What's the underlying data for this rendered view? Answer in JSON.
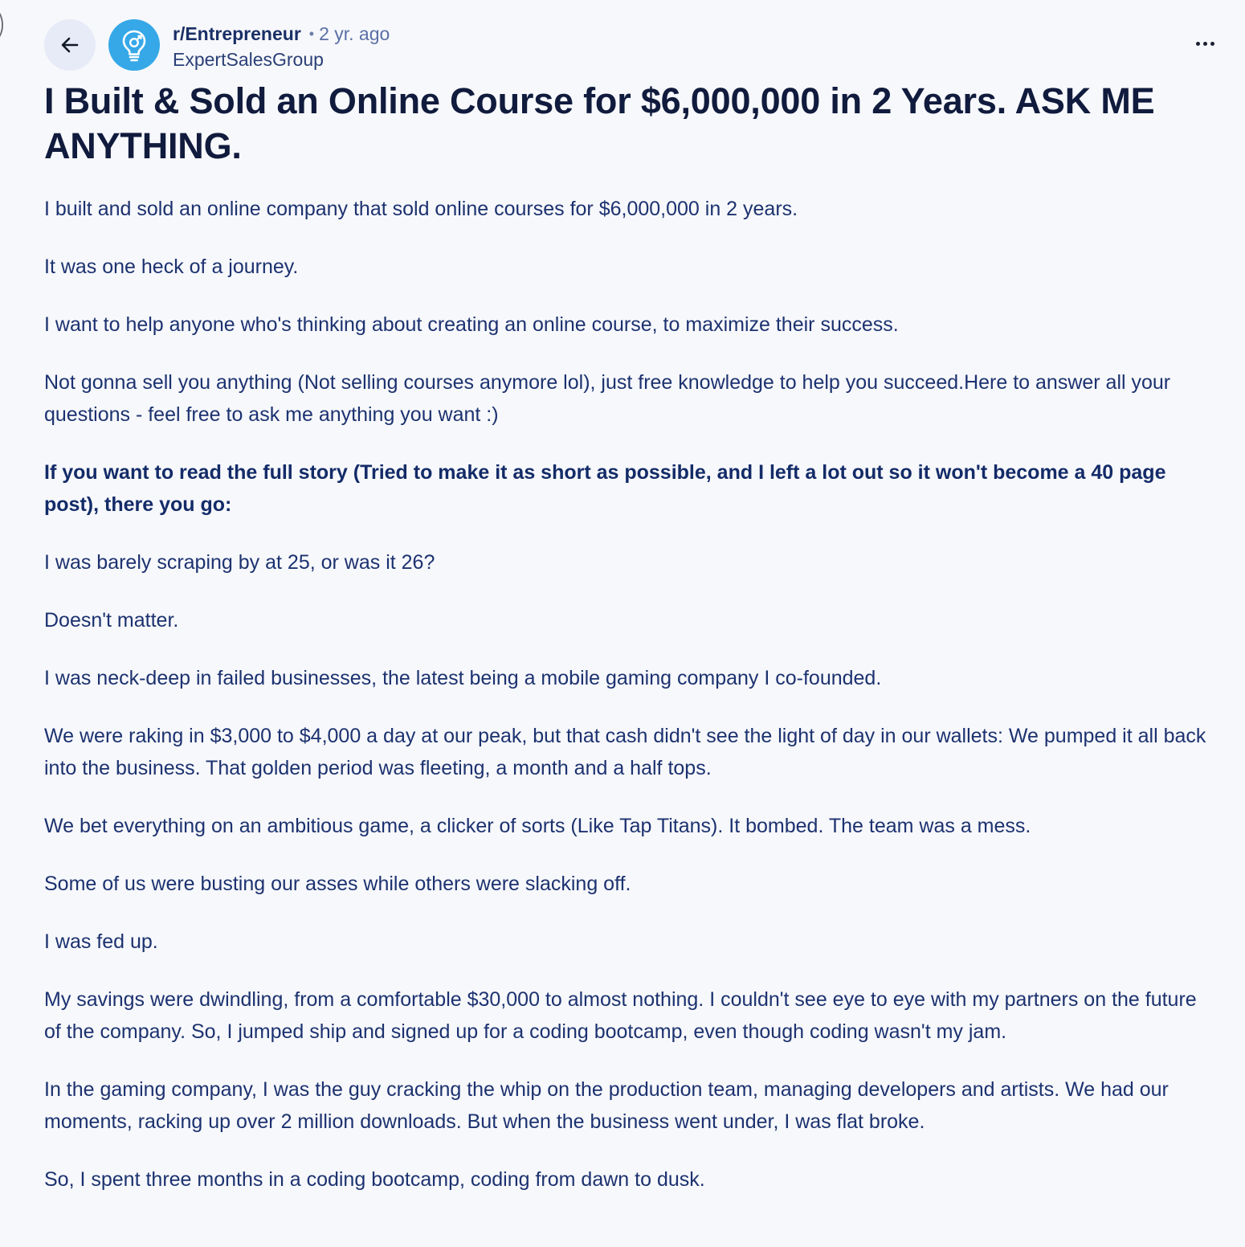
{
  "header": {
    "subreddit": "r/Entrepreneur",
    "dot": "•",
    "time": "2 yr. ago",
    "author": "ExpertSalesGroup",
    "back_icon": "arrow-left-icon",
    "avatar_icon": "lightbulb-icon",
    "more_icon": "ellipsis-horizontal-icon"
  },
  "post": {
    "title": "I Built & Sold an Online Course for $6,000,000 in 2 Years. ASK ME ANYTHING.",
    "paragraphs": [
      {
        "text": "I built and sold an online company that sold online courses for $6,000,000 in 2 years.",
        "bold": false
      },
      {
        "text": "It was one heck of a journey.",
        "bold": false
      },
      {
        "text": "I want to help anyone who's thinking about creating an online course, to maximize their success.",
        "bold": false
      },
      {
        "text": "Not gonna sell you anything (Not selling courses anymore lol), just free knowledge to help you succeed.Here to answer all your questions - feel free to ask me anything you want :)",
        "bold": false
      },
      {
        "text": "If you want to read the full story (Tried to make it as short as possible, and I left a lot out so it won't become a 40 page post), there you go:",
        "bold": true
      },
      {
        "text": "I was barely scraping by at 25, or was it 26?",
        "bold": false
      },
      {
        "text": "Doesn't matter.",
        "bold": false
      },
      {
        "text": "I was neck-deep in failed businesses, the latest being a mobile gaming company I co-founded.",
        "bold": false
      },
      {
        "text": "We were raking in $3,000 to $4,000 a day at our peak, but that cash didn't see the light of day in our wallets: We pumped it all back into the business. That golden period was fleeting, a month and a half tops.",
        "bold": false
      },
      {
        "text": "We bet everything on an ambitious game, a clicker of sorts (Like Tap Titans). It bombed. The team was a mess.",
        "bold": false
      },
      {
        "text": "Some of us were busting our asses while others were slacking off.",
        "bold": false
      },
      {
        "text": "I was fed up.",
        "bold": false
      },
      {
        "text": "My savings were dwindling, from a comfortable $30,000 to almost nothing. I couldn't see eye to eye with my partners on the future of the company. So, I jumped ship and signed up for a coding bootcamp, even though coding wasn't my jam.",
        "bold": false
      },
      {
        "text": "In the gaming company, I was the guy cracking the whip on the production team, managing developers and artists. We had our moments, racking up over 2 million downloads. But when the business went under, I was flat broke.",
        "bold": false
      },
      {
        "text": "So, I spent three months in a coding bootcamp, coding from dawn to dusk.",
        "bold": false
      }
    ]
  },
  "colors": {
    "background": "#f7f8fb",
    "title": "#101b3d",
    "body": "#1c3270",
    "avatar": "#36a8e8",
    "back_button": "#e7ebf8"
  }
}
